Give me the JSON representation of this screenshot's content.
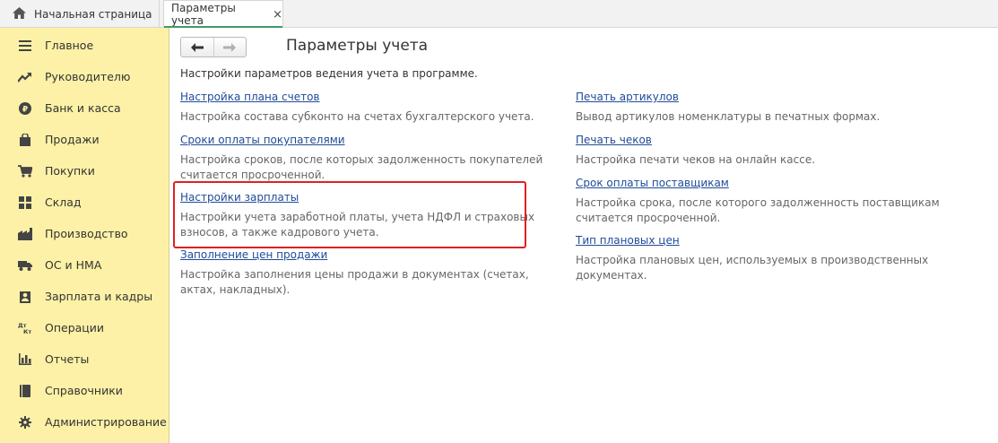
{
  "tabs": {
    "home_label": "Начальная страница",
    "params_label": "Параметры учета",
    "close_glyph": "×"
  },
  "sidebar": {
    "items": [
      {
        "label": "Главное",
        "icon": "menu-icon"
      },
      {
        "label": "Руководителю",
        "icon": "trend-icon"
      },
      {
        "label": "Банк и касса",
        "icon": "coin-icon"
      },
      {
        "label": "Продажи",
        "icon": "shopping-bag-icon"
      },
      {
        "label": "Покупки",
        "icon": "cart-icon"
      },
      {
        "label": "Склад",
        "icon": "warehouse-icon"
      },
      {
        "label": "Производство",
        "icon": "factory-icon"
      },
      {
        "label": "ОС и НМА",
        "icon": "truck-icon"
      },
      {
        "label": "Зарплата и кадры",
        "icon": "person-icon"
      },
      {
        "label": "Операции",
        "icon": "dt-kt-icon"
      },
      {
        "label": "Отчеты",
        "icon": "bar-chart-icon"
      },
      {
        "label": "Справочники",
        "icon": "book-icon"
      },
      {
        "label": "Администрирование",
        "icon": "gear-icon"
      }
    ],
    "dt_glyph": "Дт",
    "kt_glyph": "Кт"
  },
  "page": {
    "title": "Параметры учета",
    "description": "Настройки параметров ведения учета в программе."
  },
  "left_column": [
    {
      "link": "Настройка плана счетов",
      "desc": "Настройка состава субконто на счетах бухгалтерского учета."
    },
    {
      "link": "Сроки оплаты покупателями",
      "desc_lines": [
        "Настройка сроков, после которых задолженность покупателей",
        "считается просроченной."
      ]
    },
    {
      "link": "Настройки зарплаты",
      "desc_lines": [
        "Настройки учета заработной платы, учета НДФЛ и страховых",
        "взносов, а также кадрового учета."
      ],
      "highlighted": true
    },
    {
      "link": "Заполнение цен продажи",
      "desc_lines": [
        "Настройка заполнения цены продажи в документах (счетах,",
        "актах, накладных)."
      ]
    }
  ],
  "right_column": [
    {
      "link": "Печать артикулов",
      "desc": "Вывод артикулов номенклатуры в печатных формах."
    },
    {
      "link": "Печать чеков",
      "desc": "Настройка печати чеков на онлайн кассе."
    },
    {
      "link": "Срок оплаты поставщикам",
      "desc_lines": [
        "Настройка срока, после которого задолженность поставщикам",
        "считается просроченной."
      ]
    },
    {
      "link": "Тип плановых цен",
      "desc_lines": [
        "Настройка плановых цен, используемых в производственных",
        "документах."
      ]
    }
  ],
  "colors": {
    "sidebar_bg": "#fcf1a6",
    "link": "#1f4b99",
    "highlight_border": "#e02020",
    "active_tab_line": "#3f9a6b"
  }
}
